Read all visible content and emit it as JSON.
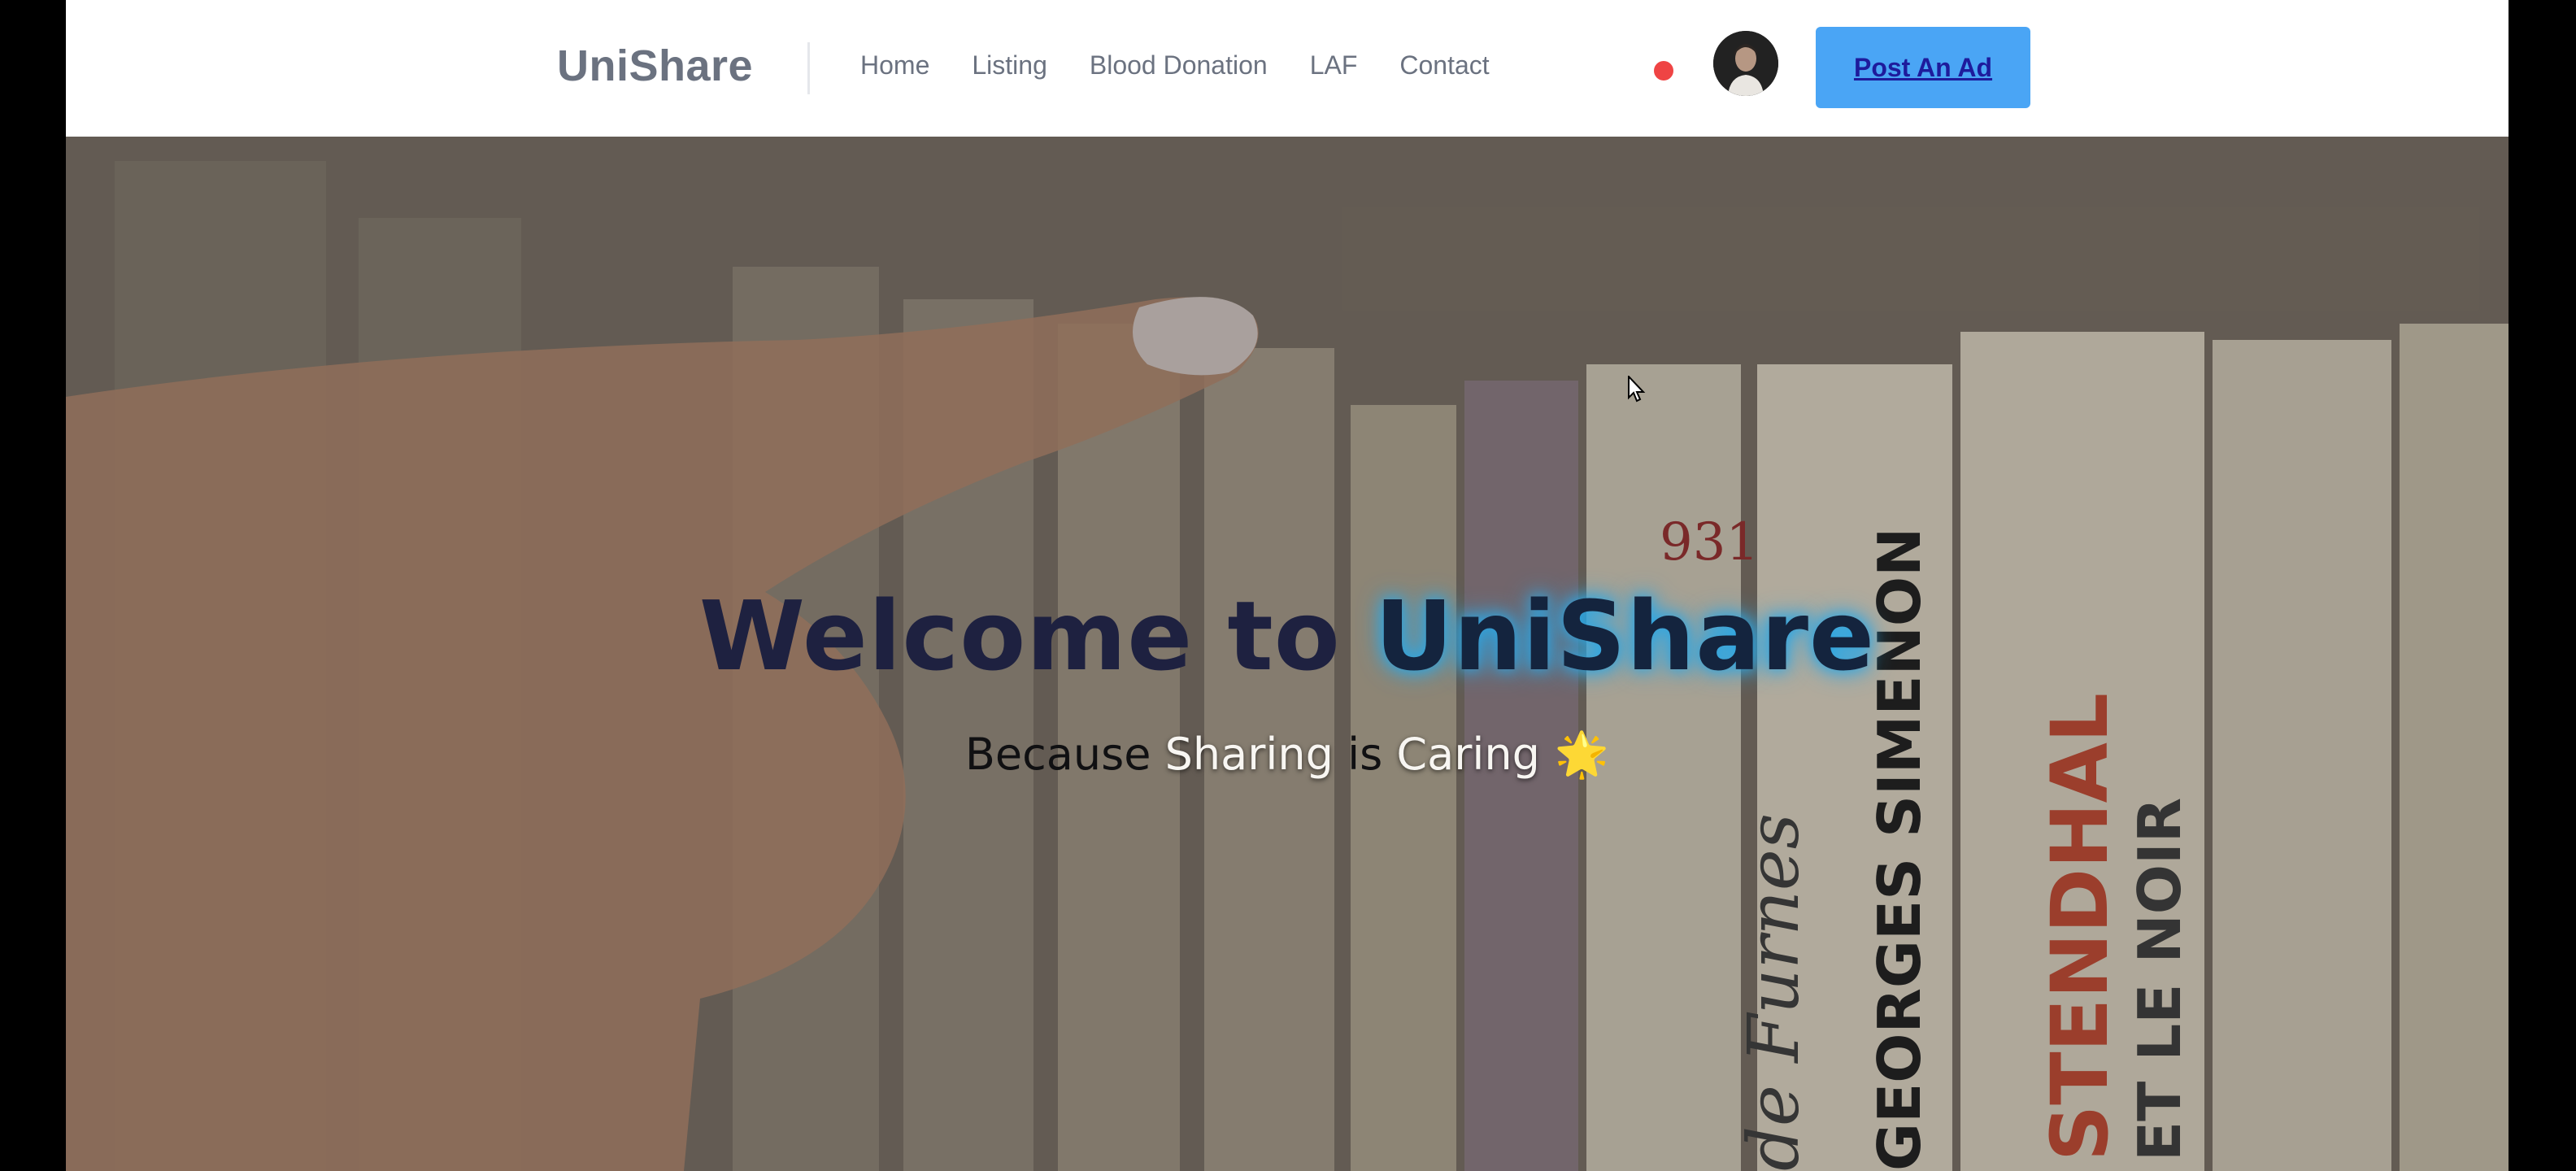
{
  "header": {
    "logo": "UniShare",
    "nav": [
      {
        "label": "Home"
      },
      {
        "label": "Listing"
      },
      {
        "label": "Blood Donation"
      },
      {
        "label": "LAF"
      },
      {
        "label": "Contact"
      }
    ],
    "post_button": "Post An Ad",
    "notification_color": "#ef4444",
    "button_color": "#4aa5f5"
  },
  "hero": {
    "title_prefix": "Welcome to ",
    "title_brand": "UniShare",
    "subtitle_parts": [
      "Because ",
      "Sharing",
      " is ",
      "Caring"
    ],
    "subtitle_emoji": "🌟",
    "book_labels": [
      "931",
      "GEORGES SIMENON",
      "STENDHAL",
      "ET LE NOIR",
      "de Furnes"
    ]
  }
}
